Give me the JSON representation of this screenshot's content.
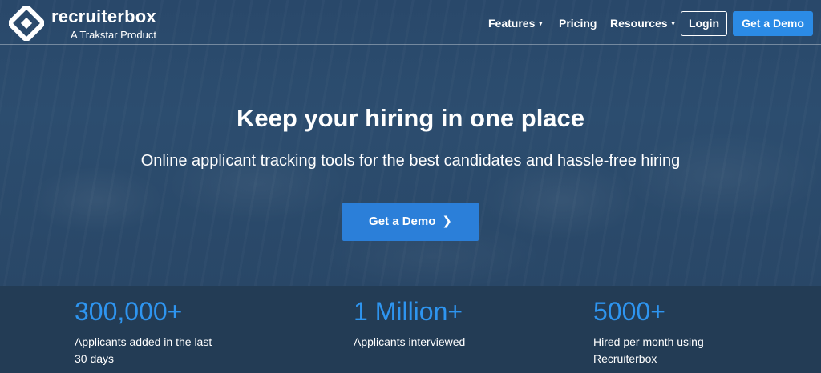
{
  "brand": {
    "name": "recruiterbox",
    "tagline": "A Trakstar Product"
  },
  "nav": {
    "features": "Features",
    "pricing": "Pricing",
    "resources": "Resources",
    "login": "Login",
    "get_demo": "Get a Demo"
  },
  "hero": {
    "title": "Keep your hiring in one place",
    "subtitle": "Online applicant tracking tools for the best candidates and hassle-free hiring",
    "cta": "Get a Demo"
  },
  "stats": [
    {
      "value": "300,000+",
      "label": "Applicants added in the last 30 days"
    },
    {
      "value": "1 Million+",
      "label": "Applicants interviewed"
    },
    {
      "value": "5000+",
      "label": "Hired per month using Recruiterbox"
    }
  ],
  "colors": {
    "background": "#233c55",
    "accent": "#2b8be6",
    "stat_value": "#2e95f0"
  }
}
